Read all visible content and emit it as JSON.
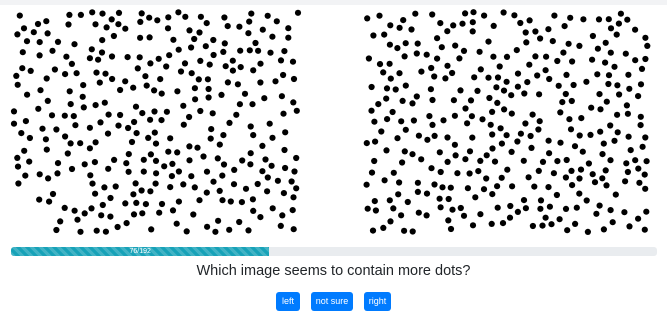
{
  "progress": {
    "value_percent": 40,
    "label": "76/192"
  },
  "question": "Which image seems to contain more dots?",
  "buttons": {
    "left": "left",
    "not_sure": "not sure",
    "right": "right"
  },
  "colors": {
    "dot": "#000000",
    "progress": "#17a2b8",
    "button": "#007bff"
  }
}
